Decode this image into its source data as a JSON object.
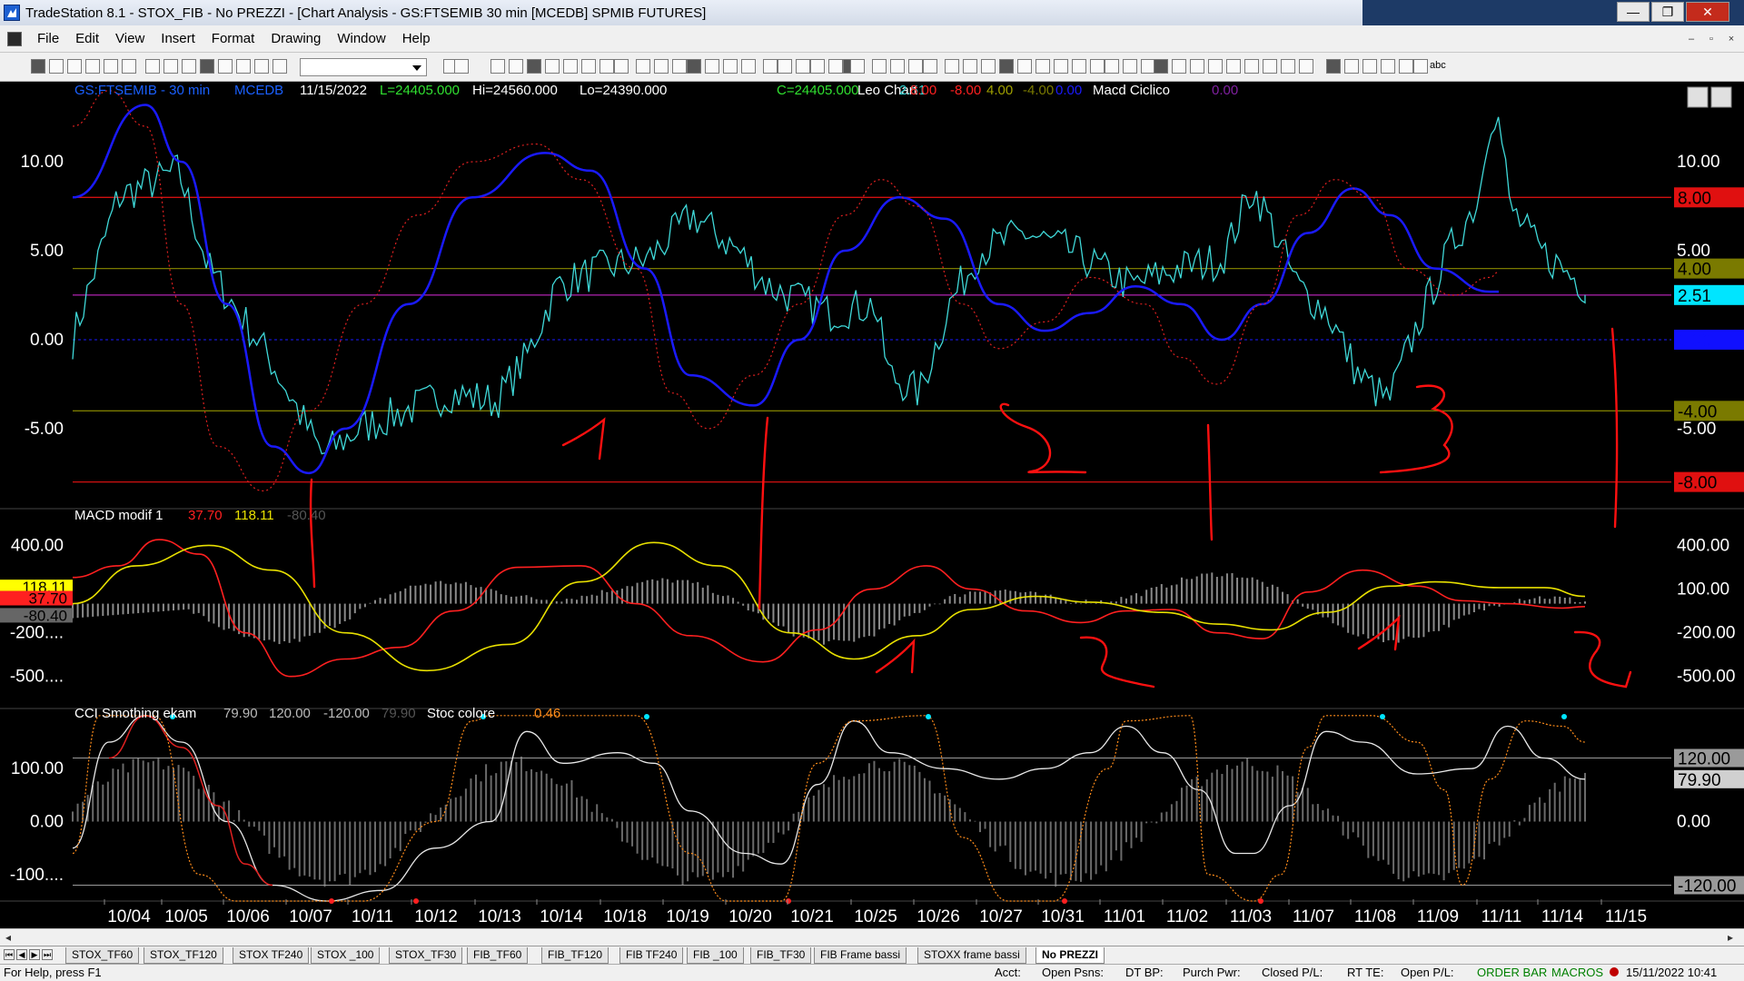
{
  "window": {
    "title": "TradeStation 8.1 - STOX_FIB - No PREZZI - [Chart Analysis - GS:FTSEMIB  30 min  [MCEDB] SPMIB FUTURES]",
    "controls": {
      "minimize": "—",
      "restore": "❐",
      "close": "✕"
    }
  },
  "menu": [
    "File",
    "Edit",
    "View",
    "Insert",
    "Format",
    "Drawing",
    "Window",
    "Help"
  ],
  "mdi_controls": {
    "minimize": "–",
    "restore": "▫",
    "close": "×"
  },
  "toolbar": {
    "text_tool": "abc"
  },
  "chart": {
    "header": {
      "symbol": "GS:FTSEMIB - 30 min",
      "source": "MCEDB",
      "date": "11/15/2022",
      "last": "L=24405.000",
      "high": "Hi=24560.000",
      "low": "Lo=24390.000",
      "close": "C=24405.000",
      "study": "Leo Chart",
      "values": [
        "2.51",
        "8.00",
        "-8.00",
        "4.00",
        "-4.00",
        "0.00"
      ],
      "study2": "Macd Ciclico",
      "study2_value": "0.00"
    },
    "macd_header": {
      "name": "MACD modif 1",
      "v1": "37.70",
      "v2": "118.11",
      "v3": "-80.40"
    },
    "cci_header": {
      "name": "CCI Smothing ekam",
      "values": [
        "79.90",
        "120.00",
        "-120.00",
        "79.90"
      ],
      "name2": "Stoc colore",
      "value2": "0.46"
    },
    "panel1_axis": [
      "10.00",
      "5.00",
      "0.00",
      "-5.00"
    ],
    "panel1_tags": [
      {
        "text": "8.00",
        "bg": "#e01010",
        "fg": "#000000",
        "v": 8
      },
      {
        "text": "4.00",
        "bg": "#7a7a00",
        "fg": "#000000",
        "v": 4
      },
      {
        "text": "2.51",
        "bg": "#00e5ff",
        "fg": "#000000",
        "v": 2.51
      },
      {
        "text": "0.00",
        "bg": "#1010ff",
        "fg": "#1010ff",
        "v": 0
      },
      {
        "text": "-4.00",
        "bg": "#7a7a00",
        "fg": "#000000",
        "v": -4
      },
      {
        "text": "-8.00",
        "bg": "#e01010",
        "fg": "#000000",
        "v": -8
      }
    ],
    "panel2_axis": [
      "400.00",
      "100.00",
      "-200.00",
      "-500.00"
    ],
    "panel2_left_axis": [
      "400.00",
      "-200....",
      "-500...."
    ],
    "panel2_left_tags": [
      {
        "text": "118.11",
        "bg": "#ffff00"
      },
      {
        "text": "37.70",
        "bg": "#ff2020"
      },
      {
        "text": "-80.40",
        "bg": "#666666"
      }
    ],
    "panel3_axis": [
      "100.00",
      "0.00",
      "-100...."
    ],
    "panel3_right_axis": [
      "0.00",
      "100.00",
      "-120.00"
    ],
    "panel3_tags": [
      {
        "text": "120.00",
        "bg": "#9a9a9a"
      },
      {
        "text": "79.90",
        "bg": "#d0d0d0"
      },
      {
        "text": "-120.00",
        "bg": "#9a9a9a"
      }
    ],
    "dates": [
      "10/04",
      "10/05",
      "10/06",
      "10/07",
      "10/11",
      "10/12",
      "10/13",
      "10/14",
      "10/18",
      "10/19",
      "10/20",
      "10/21",
      "10/25",
      "10/26",
      "10/27",
      "10/31",
      "11/01",
      "11/02",
      "11/03",
      "11/07",
      "11/08",
      "11/09",
      "11/11",
      "11/14",
      "11/15"
    ],
    "colors": {
      "price": "#3fd8d8",
      "cycle": "#1a1aff",
      "dotted": "#e02020",
      "macd": "#ff2020",
      "signal": "#e8e000",
      "hist": "#8a8a8a",
      "cci": "#e8e8e8",
      "stoch": "#ff8c1a"
    }
  },
  "tabs": [
    "STOX_TF60",
    "STOX_TF120",
    "STOX TF240",
    "STOX _100",
    "STOX_TF30",
    "FIB_TF60",
    "FIB_TF120",
    "FIB TF240",
    "FIB _100",
    "FIB_TF30",
    "FIB Frame bassi",
    "STOXX frame bassi",
    "No PREZZI"
  ],
  "status": {
    "help": "For Help, press F1",
    "acct": "Acct:",
    "open_psns": "Open Psns:",
    "dt_bp": "DT BP:",
    "purch_pwr": "Purch Pwr:",
    "closed_pl": "Closed P/L:",
    "rt_te": "RT TE:",
    "open_pl": "Open P/L:",
    "order_bar": "ORDER BAR",
    "macros": "MACROS",
    "datetime": "15/11/2022 10:41"
  }
}
